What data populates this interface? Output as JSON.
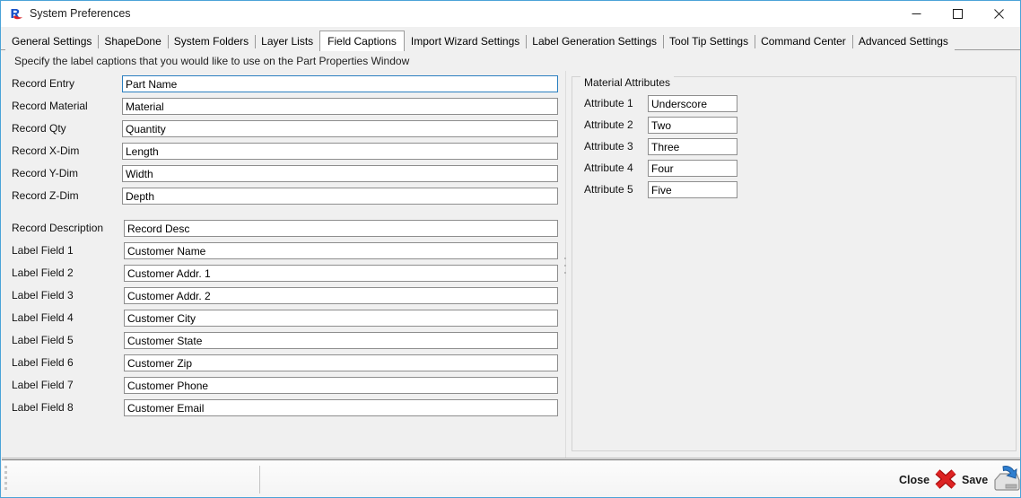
{
  "window": {
    "title": "System Preferences",
    "app_icon": "r-logo-icon",
    "controls": {
      "minimize": "minimize-icon",
      "maximize": "maximize-icon",
      "close": "close-icon"
    }
  },
  "tabs": [
    {
      "label": "General Settings",
      "selected": false
    },
    {
      "label": "ShapeDone",
      "selected": false
    },
    {
      "label": "System Folders",
      "selected": false
    },
    {
      "label": "Layer Lists",
      "selected": false
    },
    {
      "label": "Field Captions",
      "selected": true
    },
    {
      "label": "Import Wizard Settings",
      "selected": false
    },
    {
      "label": "Label Generation Settings",
      "selected": false
    },
    {
      "label": "Tool Tip Settings",
      "selected": false
    },
    {
      "label": "Command Center",
      "selected": false
    },
    {
      "label": "Advanced Settings",
      "selected": false
    }
  ],
  "content": {
    "hint": "Specify the label captions that you would like to use on the Part Properties Window",
    "record_fields": [
      {
        "label": "Record Entry",
        "value": "Part Name",
        "focused": true
      },
      {
        "label": "Record Material",
        "value": "Material",
        "focused": false
      },
      {
        "label": "Record Qty",
        "value": "Quantity",
        "focused": false
      },
      {
        "label": "Record X-Dim",
        "value": "Length",
        "focused": false
      },
      {
        "label": "Record Y-Dim",
        "value": "Width",
        "focused": false
      },
      {
        "label": "Record Z-Dim",
        "value": "Depth",
        "focused": false
      }
    ],
    "label_fields": [
      {
        "label": "Record Description",
        "value": "Record Desc"
      },
      {
        "label": "Label Field 1",
        "value": "Customer Name"
      },
      {
        "label": "Label Field 2",
        "value": "Customer Addr. 1"
      },
      {
        "label": "Label Field 3",
        "value": "Customer Addr. 2"
      },
      {
        "label": "Label Field 4",
        "value": "Customer City"
      },
      {
        "label": "Label Field 5",
        "value": "Customer State"
      },
      {
        "label": "Label Field 6",
        "value": "Customer Zip"
      },
      {
        "label": "Label Field 7",
        "value": "Customer Phone"
      },
      {
        "label": "Label Field 8",
        "value": "Customer Email"
      }
    ],
    "material_attributes": {
      "title": "Material Attributes",
      "rows": [
        {
          "label": "Attribute 1",
          "value": "Underscore"
        },
        {
          "label": "Attribute 2",
          "value": "Two"
        },
        {
          "label": "Attribute 3",
          "value": "Three"
        },
        {
          "label": "Attribute 4",
          "value": "Four"
        },
        {
          "label": "Attribute 5",
          "value": "Five"
        }
      ]
    }
  },
  "statusbar": {
    "close_label": "Close",
    "close_icon": "red-x-icon",
    "save_label": "Save",
    "save_icon": "save-disk-icon"
  },
  "colors": {
    "window_border": "#4ba3d8",
    "face": "#f0f0f0",
    "field_border": "#8e8e8e",
    "focus_border": "#2a7fc0",
    "close_red": "#cc1111",
    "save_blue": "#2a72c8"
  }
}
